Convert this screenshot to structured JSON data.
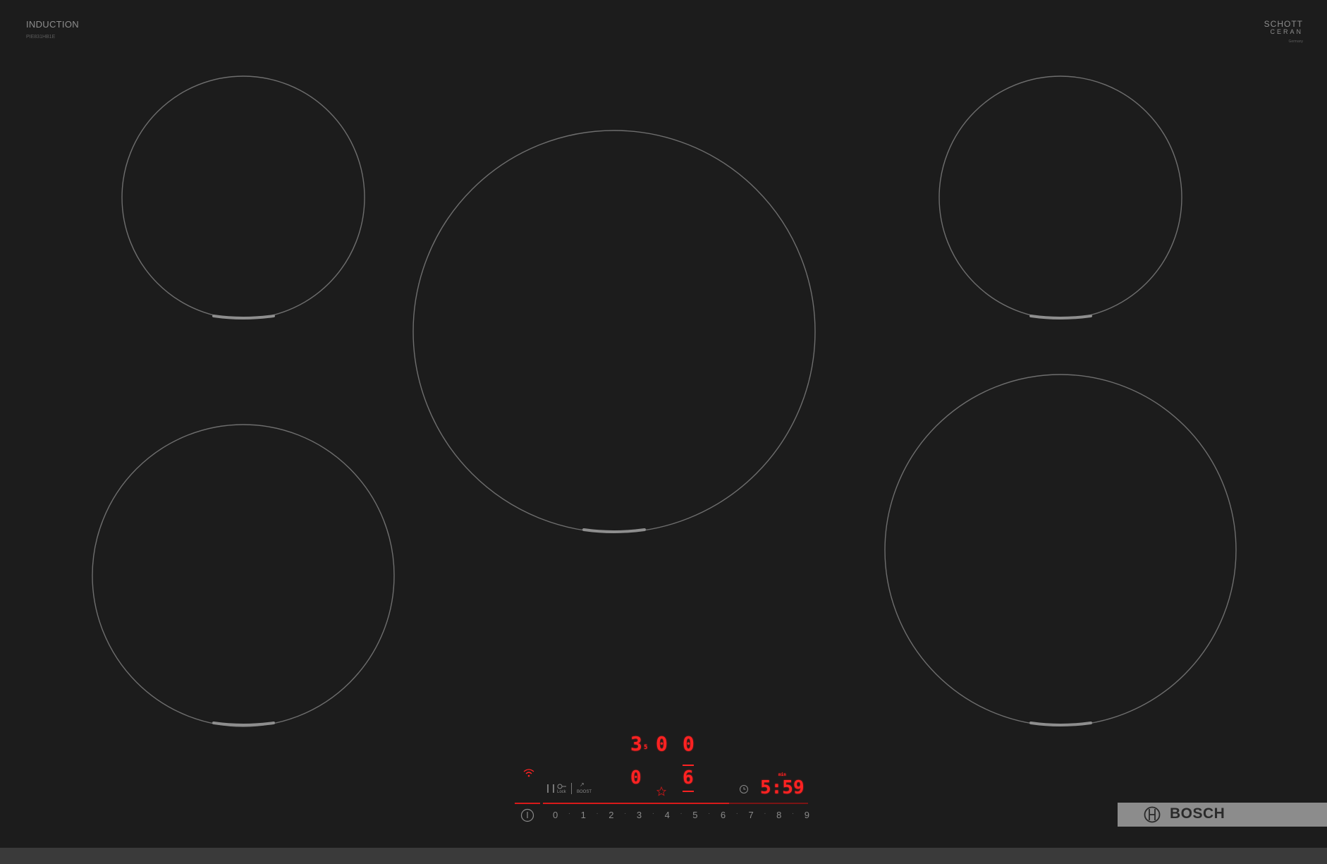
{
  "header": {
    "product_type": "INDUCTION",
    "model_number": "PIE831HB1E"
  },
  "glass_brand": {
    "line1": "SCHOTT",
    "line2": "CERAN",
    "line3": "Germany"
  },
  "cooking_zones": [
    {
      "name": "front-left"
    },
    {
      "name": "rear-left"
    },
    {
      "name": "center"
    },
    {
      "name": "rear-right"
    },
    {
      "name": "front-right"
    }
  ],
  "control_panel": {
    "display_top_digit1": "3",
    "display_top_sub": "5",
    "display_top_digit2": "0",
    "display_top_digit3": "0",
    "zone_level": "0",
    "zone_level2": "6",
    "timer_label": "min",
    "timer_value": "5:59",
    "lock_label": "Lock",
    "boost_label": "BOOST",
    "power_scale": [
      "0",
      "1",
      "2",
      "3",
      "4",
      "5",
      "6",
      "7",
      "8",
      "9"
    ]
  },
  "brand_bar": {
    "name": "BOSCH"
  },
  "colors": {
    "glass": "#1c1c1c",
    "zone_outline": "#6e6e6e",
    "led_red": "#ff2222",
    "brand_bar": "#8c8c8c"
  }
}
